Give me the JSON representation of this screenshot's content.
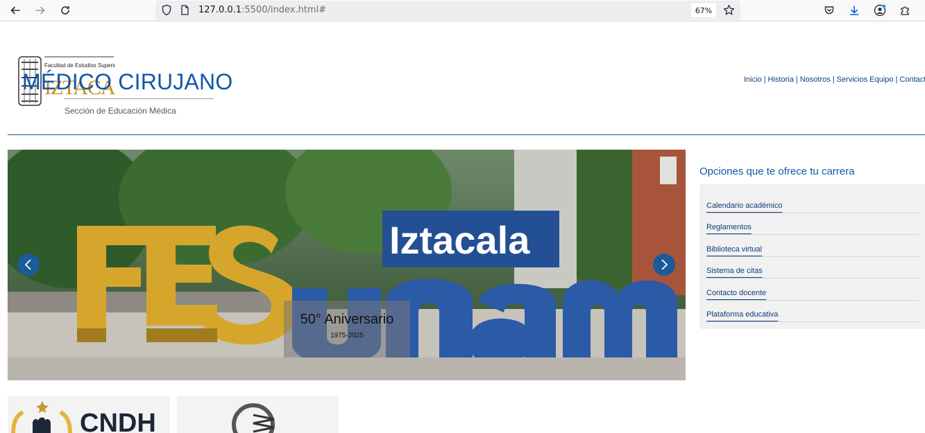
{
  "browser": {
    "url_host": "127.0.0.1",
    "url_rest": ":5500/index.html#",
    "zoom": "67%"
  },
  "header": {
    "logo_line1": "Facultad de Estudios Superiores",
    "logo_line2": "IZTACALA",
    "title": "MÉDICO CIRUJANO",
    "subtitle": "Sección de Educación Médica"
  },
  "nav": {
    "items": [
      "Inicio",
      "Historia",
      "Nosotros",
      "Servicios Equipo",
      "Contacto"
    ],
    "separator": "|"
  },
  "carousel": {
    "caption_title": "50° Aniversario",
    "caption_subtitle": "1975-2025",
    "sign_text_left": "FES",
    "sign_text_top": "Iztacala",
    "sign_text_right": "unam"
  },
  "sidebar": {
    "heading": "Opciones que te ofrece tu carrera",
    "items": [
      "Calendario académico",
      "Reglamentos",
      "Biblioteca virtual",
      "Sistema de citas",
      "Contacto docente",
      "Plataforma educativa"
    ]
  },
  "cards": {
    "card1_text": "CNDH"
  },
  "colors": {
    "brand_blue": "#0f58a8",
    "nav_blue": "#0d3e78",
    "arrow_blue": "#1c5a99"
  }
}
